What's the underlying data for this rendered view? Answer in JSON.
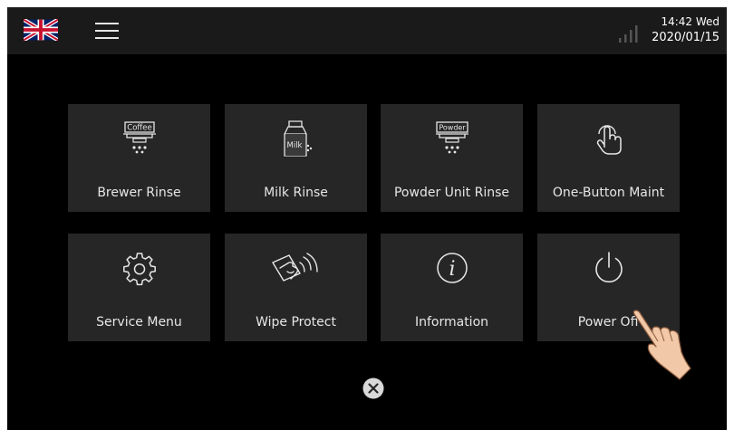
{
  "status": {
    "time": "14:42 Wed",
    "date": "2020/01/15"
  },
  "tiles": [
    {
      "label": "Brewer Rinse",
      "icon": "brewer-icon",
      "icon_text": "Coffee"
    },
    {
      "label": "Milk Rinse",
      "icon": "milk-carton-icon",
      "icon_text": "Milk"
    },
    {
      "label": "Powder Unit Rinse",
      "icon": "powder-icon",
      "icon_text": "Powder"
    },
    {
      "label": "One-Button Maint",
      "icon": "touch-icon"
    },
    {
      "label": "Service Menu",
      "icon": "gear-icon"
    },
    {
      "label": "Wipe Protect",
      "icon": "wipe-icon"
    },
    {
      "label": "Information",
      "icon": "info-icon",
      "icon_text": "i"
    },
    {
      "label": "Power Off",
      "icon": "power-icon"
    }
  ],
  "colors": {
    "background": "#000000",
    "topbar": "#1a1a1a",
    "tile": "#262626",
    "text": "#e6e6e6"
  }
}
